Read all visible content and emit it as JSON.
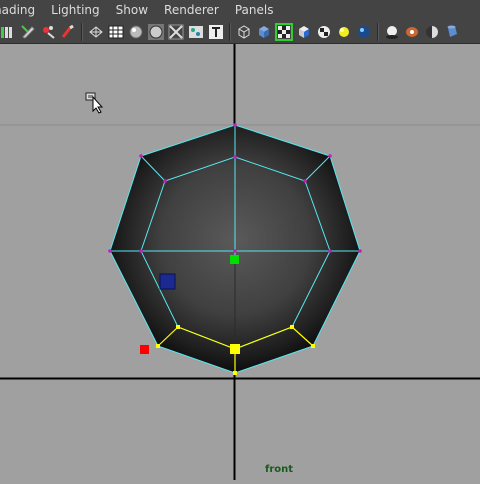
{
  "menu": {
    "items": [
      "hading",
      "Lighting",
      "Show",
      "Renderer",
      "Panels"
    ]
  },
  "toolbar": {
    "icons": [
      "key-icon",
      "edit-pencil-icon",
      "paint-brush-icon",
      "magnet-icon",
      "separator",
      "wireframe-icon",
      "grid-shade-icon",
      "smooth-shade-icon",
      "flat-shade-icon",
      "xray-icon",
      "texture-icon",
      "text-icon",
      "separator",
      "cube-wire-icon",
      "cube-solid-icon",
      "checker-icon",
      "cube-icon",
      "checkerboard-icon",
      "light-bulb-icon",
      "sphere-icon",
      "separator",
      "shadow-icon",
      "render-icon",
      "half-sphere-icon",
      "cylinder-icon"
    ]
  },
  "viewport": {
    "label": "front",
    "background_color": "#a0a0a0",
    "wire_color": "#55e8f0",
    "vertex_color": "#c020c0",
    "selected_color": "#ffff00",
    "pivot_color": "#00dd00",
    "handle_color": "#ff0000",
    "manipulator_color": "#1a2a90"
  }
}
